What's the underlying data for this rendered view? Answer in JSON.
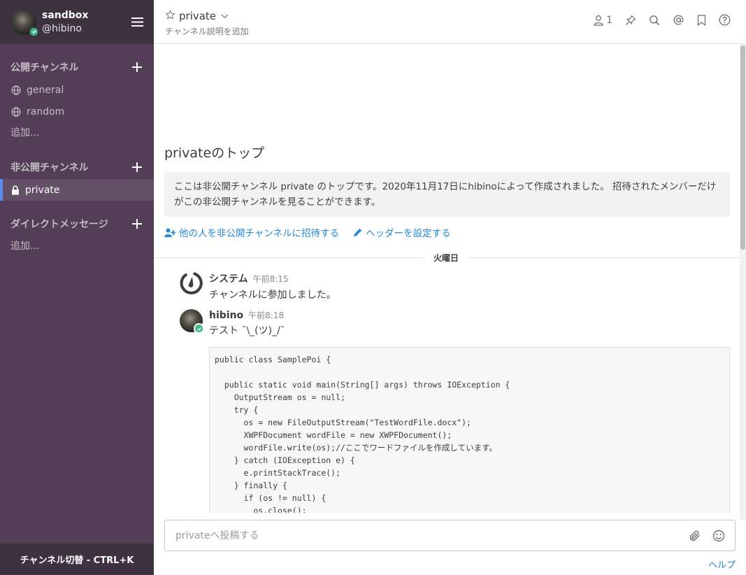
{
  "team": {
    "name": "sandbox",
    "username": "@hibino"
  },
  "sidebar": {
    "public_section": {
      "title": "公開チャンネル",
      "channels": [
        {
          "label": "general"
        },
        {
          "label": "random"
        }
      ],
      "add_more": "追加..."
    },
    "private_section": {
      "title": "非公開チャンネル",
      "channels": [
        {
          "label": "private"
        }
      ]
    },
    "dm_section": {
      "title": "ダイレクトメッセージ",
      "add_more": "追加..."
    },
    "switcher": "チャンネル切替 - CTRL+K"
  },
  "header": {
    "channel_name": "private",
    "description_link": "チャンネル説明を追加",
    "member_count": "1"
  },
  "intro": {
    "title": "privateのトップ",
    "description": "ここは非公開チャンネル private のトップです。2020年11月17日にhibinoによって作成されました。 招待されたメンバーだけがこの非公開チャンネルを見ることができます。",
    "invite_action": "他の人を非公開チャンネルに招待する",
    "header_action": "ヘッダーを設定する"
  },
  "date_separator": "火曜日",
  "posts": [
    {
      "user": "システム",
      "time": "午前8:15",
      "message": "チャンネルに参加しました。"
    },
    {
      "user": "hibino",
      "time": "午前8:18",
      "message": "テスト ¯\\_(ツ)_/¯",
      "code": "public class SamplePoi {\n\n  public static void main(String[] args) throws IOException {\n    OutputStream os = null;\n    try {\n      os = new FileOutputStream(\"TestWordFile.docx\");\n      XWPFDocument wordFile = new XWPFDocument();\n      wordFile.write(os);//ここでワードファイルを作成しています。\n    } catch (IOException e) {\n      e.printStackTrace();\n    } finally {\n      if (os != null) {\n        os.close();\n      }"
    }
  ],
  "composer": {
    "placeholder": "privateへ投稿する"
  },
  "help_link": "ヘルプ",
  "colors": {
    "sidebar_bg": "#543e57",
    "sidebar_header_bg": "#3e3241",
    "active_channel_bg": "#634f66",
    "active_border": "#5d89ea",
    "link": "#2389d7",
    "online": "#3db887"
  },
  "icons": {
    "menu": "hamburger-icon",
    "public_channel": "globe-icon",
    "private_channel": "lock-icon",
    "favorite": "star-icon",
    "dropdown": "chevron-down-icon",
    "members": "member-icon",
    "pin": "pin-icon",
    "search": "search-icon",
    "mention": "at-icon",
    "saved": "bookmark-icon",
    "help": "help-icon",
    "attach": "paperclip-icon",
    "emoji": "emoji-icon"
  }
}
